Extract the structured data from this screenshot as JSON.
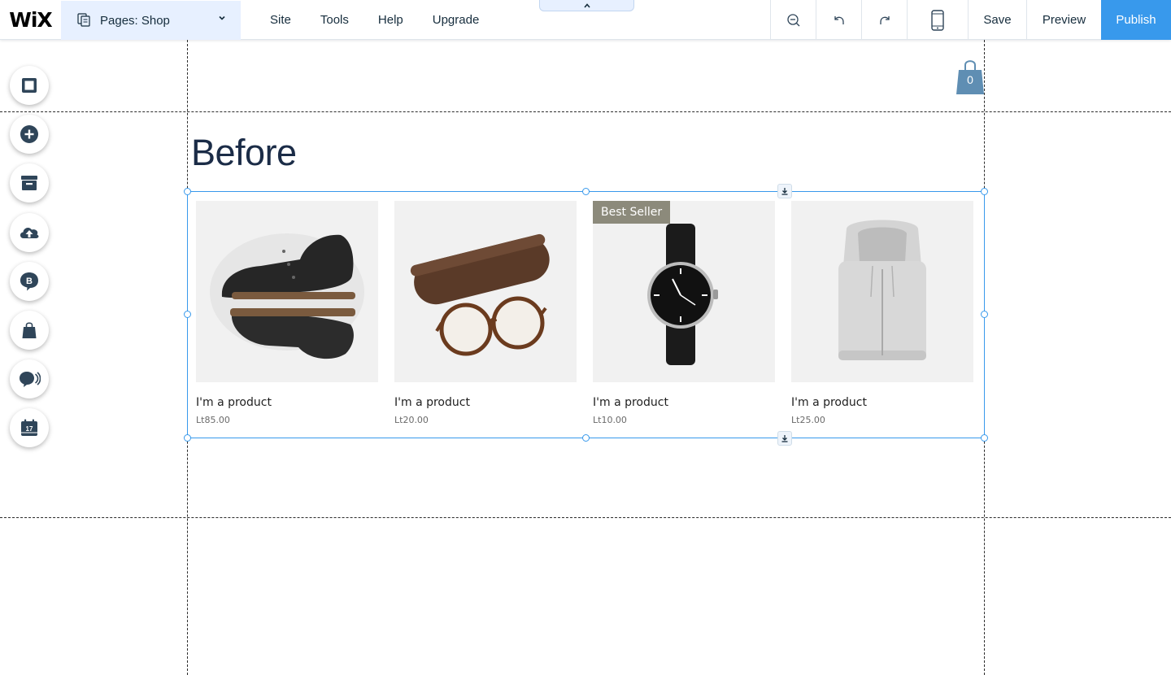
{
  "brand": {
    "logo_text": "WiX"
  },
  "pages_dropdown": {
    "label": "Pages: Shop"
  },
  "menu": [
    "Site",
    "Tools",
    "Help",
    "Upgrade"
  ],
  "toolbar": {
    "save": "Save",
    "preview": "Preview",
    "publish": "Publish"
  },
  "left_tools": [
    {
      "icon": "background-icon"
    },
    {
      "icon": "add-icon"
    },
    {
      "icon": "store-icon"
    },
    {
      "icon": "upload-icon"
    },
    {
      "icon": "blog-icon"
    },
    {
      "icon": "shopping-bag-icon"
    },
    {
      "icon": "chat-icon"
    },
    {
      "icon": "calendar-icon",
      "day": "17"
    }
  ],
  "cart": {
    "count": "0"
  },
  "section": {
    "title": "Before"
  },
  "products": [
    {
      "name": "I'm a product",
      "price": "Lt85.00",
      "ribbon": ""
    },
    {
      "name": "I'm a product",
      "price": "Lt20.00",
      "ribbon": ""
    },
    {
      "name": "I'm a product",
      "price": "Lt10.00",
      "ribbon": "Best Seller"
    },
    {
      "name": "I'm a product",
      "price": "Lt25.00",
      "ribbon": ""
    }
  ],
  "colors": {
    "accent": "#3899ec",
    "navy": "#1b2c47",
    "highlight": "#e7f0ff",
    "ribbon": "#8c8a7b",
    "toolbar_icon": "#2f4559"
  }
}
